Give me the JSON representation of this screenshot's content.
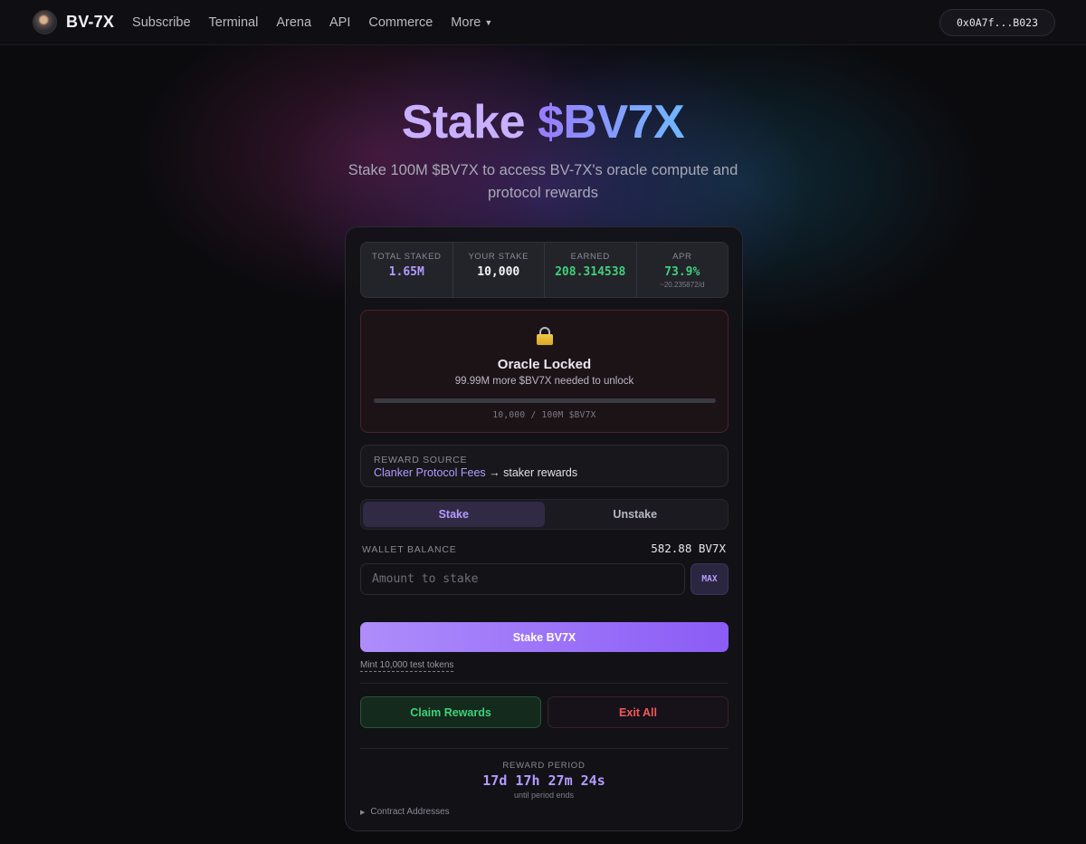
{
  "nav": {
    "brand": "BV-7X",
    "links": [
      "Subscribe",
      "Terminal",
      "Arena",
      "API",
      "Commerce"
    ],
    "more_label": "More",
    "wallet": "0x0A7f...B023"
  },
  "hero": {
    "title_part1": "Stake",
    "title_part2": "$BV7X",
    "subtitle": "Stake 100M $BV7X to access BV-7X's oracle compute and protocol rewards"
  },
  "stats": {
    "total_staked": {
      "label": "TOTAL STAKED",
      "value": "1.65M"
    },
    "your_stake": {
      "label": "YOUR STAKE",
      "value": "10,000"
    },
    "earned": {
      "label": "EARNED",
      "value": "208.314538"
    },
    "apr": {
      "label": "APR",
      "value": "73.9%",
      "sub": "~20.235872/d"
    }
  },
  "oracle": {
    "title": "Oracle Locked",
    "subtitle": "99.99M more $BV7X needed to unlock",
    "progress_fraction": 0.0001,
    "progress_text": "10,000 / 100M $BV7X"
  },
  "reward_source": {
    "label": "REWARD SOURCE",
    "link_text": "Clanker Protocol Fees",
    "rest": " → staker rewards"
  },
  "tabs": {
    "stake": "Stake",
    "unstake": "Unstake"
  },
  "wallet_balance": {
    "label": "WALLET BALANCE",
    "value": "582.88 BV7X"
  },
  "amount_input": {
    "placeholder": "Amount to stake",
    "value": ""
  },
  "max_label": "MAX",
  "stake_button": "Stake BV7X",
  "mint_link": "Mint 10,000 test tokens",
  "claim_button": "Claim Rewards",
  "exit_button": "Exit All",
  "reward_period": {
    "label": "REWARD PERIOD",
    "value": "17d 17h 27m 24s",
    "sub": "until period ends"
  },
  "contracts_label": "Contract Addresses",
  "colors": {
    "accent": "#8b5cf6",
    "accent_light": "#b39bff",
    "green": "#3ed17a",
    "red": "#f05a5a",
    "lock_gold": "#f2c94c"
  },
  "icons": {
    "lock": "lock-icon",
    "caret": "chevron-down-icon",
    "disclosure": "triangle-right-icon"
  }
}
